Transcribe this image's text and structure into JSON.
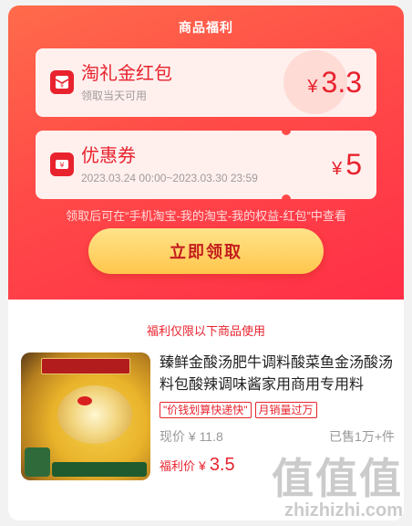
{
  "hero": {
    "title": "商品福利",
    "coupons": [
      {
        "title": "淘礼金红包",
        "subtitle": "领取当天可用",
        "currency": "¥",
        "amount": "3.3",
        "icon": "red-envelope-icon"
      },
      {
        "title": "优惠券",
        "subtitle": "2023.03.24 00:00~2023.03.30 23:59",
        "currency": "¥",
        "amount": "5",
        "icon": "coupon-ticket-icon"
      }
    ],
    "note": "领取后可在“手机淘宝-我的淘宝-我的权益-红包”中查看",
    "cta_label": "立即领取"
  },
  "section_label": "福利仅限以下商品使用",
  "product": {
    "title": "臻鲜金酸汤肥牛调料酸菜鱼金汤酸汤料包酸辣调味酱家用商用专用料",
    "tags": [
      "\"价钱划算快递快\"",
      "月销量过万"
    ],
    "current_price": "现价 ¥ 11.8",
    "sold": "已售1万+件",
    "benefit_label": "福利价",
    "benefit_currency": "¥",
    "benefit_price": "3.5"
  },
  "watermark": {
    "big": "值值值",
    "small": "zhizhizhi.com"
  },
  "colors": {
    "accent": "#e8232e",
    "hero_bg": "#ff4a48",
    "cta_bg": "#ffd066"
  }
}
